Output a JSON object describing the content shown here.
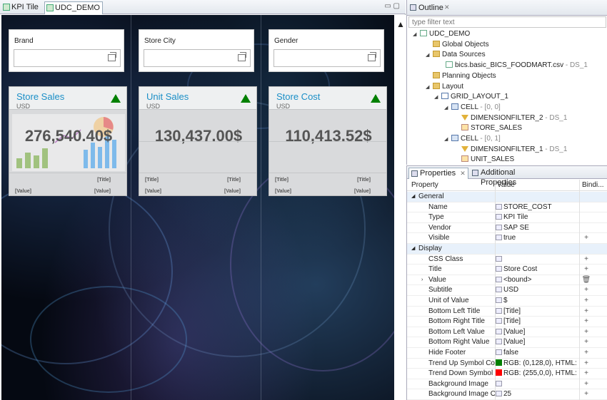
{
  "editor": {
    "tabs": [
      {
        "label": "KPI Tile",
        "active": false
      },
      {
        "label": "UDC_DEMO",
        "active": true
      }
    ],
    "filters": [
      {
        "label": "Brand"
      },
      {
        "label": "Store City"
      },
      {
        "label": "Gender"
      }
    ],
    "kpis": [
      {
        "title": "Store Sales",
        "subtitle": "USD",
        "value": "276,540.40$",
        "bottom_left_title": "",
        "bottom_right_title": "[Title]",
        "bottom_left_value": "[Value]",
        "bottom_right_value": "[Value]"
      },
      {
        "title": "Unit Sales",
        "subtitle": "USD",
        "value": "130,437.00$",
        "bottom_left_title": "[Title]",
        "bottom_right_title": "[Title]",
        "bottom_left_value": "[Value]",
        "bottom_right_value": "[Value]"
      },
      {
        "title": "Store Cost",
        "subtitle": "USD",
        "value": "110,413.52$",
        "bottom_left_title": "[Title]",
        "bottom_right_title": "[Title]",
        "bottom_left_value": "[Value]",
        "bottom_right_value": "[Value]"
      }
    ],
    "trend_up_color": "#008000"
  },
  "outline": {
    "title": "Outline",
    "filter_placeholder": "type filter text",
    "tree": [
      {
        "label": "UDC_DEMO",
        "suffix": "",
        "icon": "doc"
      },
      {
        "label": "Global Objects",
        "suffix": "",
        "icon": "folder"
      },
      {
        "label": "Data Sources",
        "suffix": "",
        "icon": "folder"
      },
      {
        "label": "bics.basic_BICS_FOODMART.csv",
        "suffix": " - DS_1",
        "icon": "doc"
      },
      {
        "label": "Planning Objects",
        "suffix": "",
        "icon": "folder"
      },
      {
        "label": "Layout",
        "suffix": "",
        "icon": "folder"
      },
      {
        "label": "GRID_LAYOUT_1",
        "suffix": "",
        "icon": "grid"
      },
      {
        "label": "CELL",
        "suffix": " - [0, 0]",
        "icon": "cell"
      },
      {
        "label": "DIMENSIONFILTER_2",
        "suffix": " - DS_1",
        "icon": "funnel"
      },
      {
        "label": "STORE_SALES",
        "suffix": "",
        "icon": "kpii"
      },
      {
        "label": "CELL",
        "suffix": " - [0, 1]",
        "icon": "cell"
      },
      {
        "label": "DIMENSIONFILTER_1",
        "suffix": " - DS_1",
        "icon": "funnel"
      },
      {
        "label": "UNIT_SALES",
        "suffix": "",
        "icon": "kpii"
      }
    ]
  },
  "properties": {
    "tabs": [
      {
        "label": "Properties"
      },
      {
        "label": "Additional Properties"
      }
    ],
    "columns": {
      "property": "Property",
      "value": "Value",
      "binding": "Bindi..."
    },
    "rows": [
      {
        "kind": "cat",
        "name": "General"
      },
      {
        "kind": "prop",
        "name": "Name",
        "value": "STORE_COST",
        "bind": ""
      },
      {
        "kind": "prop",
        "name": "Type",
        "value": "KPI Tile",
        "bind": ""
      },
      {
        "kind": "prop",
        "name": "Vendor",
        "value": "SAP SE",
        "bind": ""
      },
      {
        "kind": "prop",
        "name": "Visible",
        "value": "true",
        "bind": "+"
      },
      {
        "kind": "cat",
        "name": "Display"
      },
      {
        "kind": "prop",
        "name": "CSS Class",
        "value": "",
        "bind": "+"
      },
      {
        "kind": "prop",
        "name": "Title",
        "value": "Store Cost",
        "bind": "+"
      },
      {
        "kind": "prop",
        "name": "Value",
        "value": "<bound>",
        "bind": "🗑",
        "expand": true
      },
      {
        "kind": "prop",
        "name": "Subtitle",
        "value": "USD",
        "bind": "+"
      },
      {
        "kind": "prop",
        "name": "Unit of Value",
        "value": "$",
        "bind": "+"
      },
      {
        "kind": "prop",
        "name": "Bottom Left Title",
        "value": "[Title]",
        "bind": "+"
      },
      {
        "kind": "prop",
        "name": "Bottom Right Title",
        "value": "[Title]",
        "bind": "+"
      },
      {
        "kind": "prop",
        "name": "Bottom Left Value",
        "value": "[Value]",
        "bind": "+"
      },
      {
        "kind": "prop",
        "name": "Bottom Right Value",
        "value": "[Value]",
        "bind": "+"
      },
      {
        "kind": "prop",
        "name": "Hide Footer",
        "value": "false",
        "bind": "+"
      },
      {
        "kind": "prop",
        "name": "Trend Up Symbol Colo",
        "value": "RGB: (0,128,0),  HTML: ...",
        "bind": "+",
        "swatch": "#008000"
      },
      {
        "kind": "prop",
        "name": "Trend Down Symbol C",
        "value": "RGB: (255,0,0),  HTML: r...",
        "bind": "+",
        "swatch": "#ff0000"
      },
      {
        "kind": "prop",
        "name": "Background Image",
        "value": "",
        "bind": "+"
      },
      {
        "kind": "prop",
        "name": "Background Image Op",
        "value": "25",
        "bind": "+"
      }
    ]
  }
}
